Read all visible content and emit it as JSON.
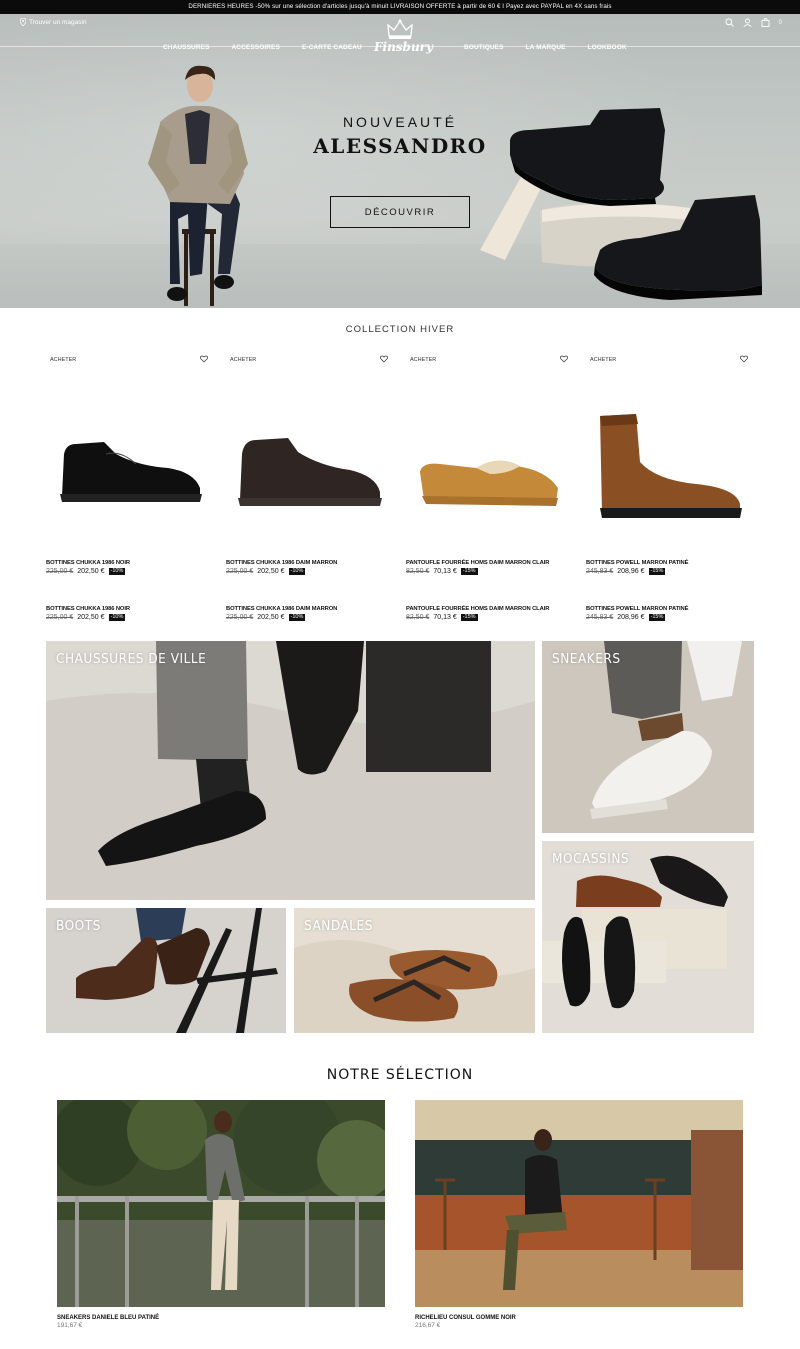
{
  "announcement": "DERNIERES HEURES -50% sur une sélection d'articles jusqu'à minuit LIVRAISON OFFERTE à partir de 60 € I Payez avec PAYPAL en 4X sans frais",
  "header": {
    "store_link": "Trouver un magasin",
    "logo": "Finsbury",
    "menu_left": [
      "CHAUSSURES",
      "ACCESSOIRES",
      "E-CARTE CADEAU"
    ],
    "menu_right": [
      "BOUTIQUES",
      "LA MARQUE",
      "LOOKBOOK"
    ],
    "icons": [
      "search-icon",
      "account-icon",
      "cart-icon",
      "bag-icon"
    ],
    "cart_count": "0"
  },
  "hero": {
    "subtitle": "NOUVEAUTÉ",
    "title": "ALESSANDRO",
    "button": "DÉCOUVRIR"
  },
  "collection": {
    "title": "COLLECTION HIVER",
    "buy_label": "ACHETER",
    "products": [
      {
        "name": "BOTTINES CHUKKA 1986 NOIR",
        "old_price": "225,00 €",
        "price": "202,50 €",
        "discount": "-10%"
      },
      {
        "name": "BOTTINES CHUKKA 1986 DAIM MARRON",
        "old_price": "225,00 €",
        "price": "202,50 €",
        "discount": "-10%"
      },
      {
        "name": "PANTOUFLE FOURRÉE HOMS DAIM MARRON CLAIR",
        "old_price": "82,50 €",
        "price": "70,13 €",
        "discount": "-15%"
      },
      {
        "name": "BOTTINES POWELL MARRON PATINÉ",
        "old_price": "245,83 €",
        "price": "208,96 €",
        "discount": "-15%"
      }
    ]
  },
  "categories": {
    "ville": "CHAUSSURES DE VILLE",
    "sneakers": "SNEAKERS",
    "mocassins": "MOCASSINS",
    "boots": "BOOTS",
    "sandales": "SANDALES"
  },
  "selection": {
    "title": "NOTRE SÉLECTION",
    "items": [
      {
        "name": "SNEAKERS DANIELE BLEU PATINÉ",
        "price": "191,67 €"
      },
      {
        "name": "RICHELIEU CONSUL GOMME NOIR",
        "price": "216,67 €"
      }
    ]
  },
  "colors": {
    "topbar": "#0b0b0b",
    "accent": "#111111",
    "discount_bg": "#111111"
  }
}
